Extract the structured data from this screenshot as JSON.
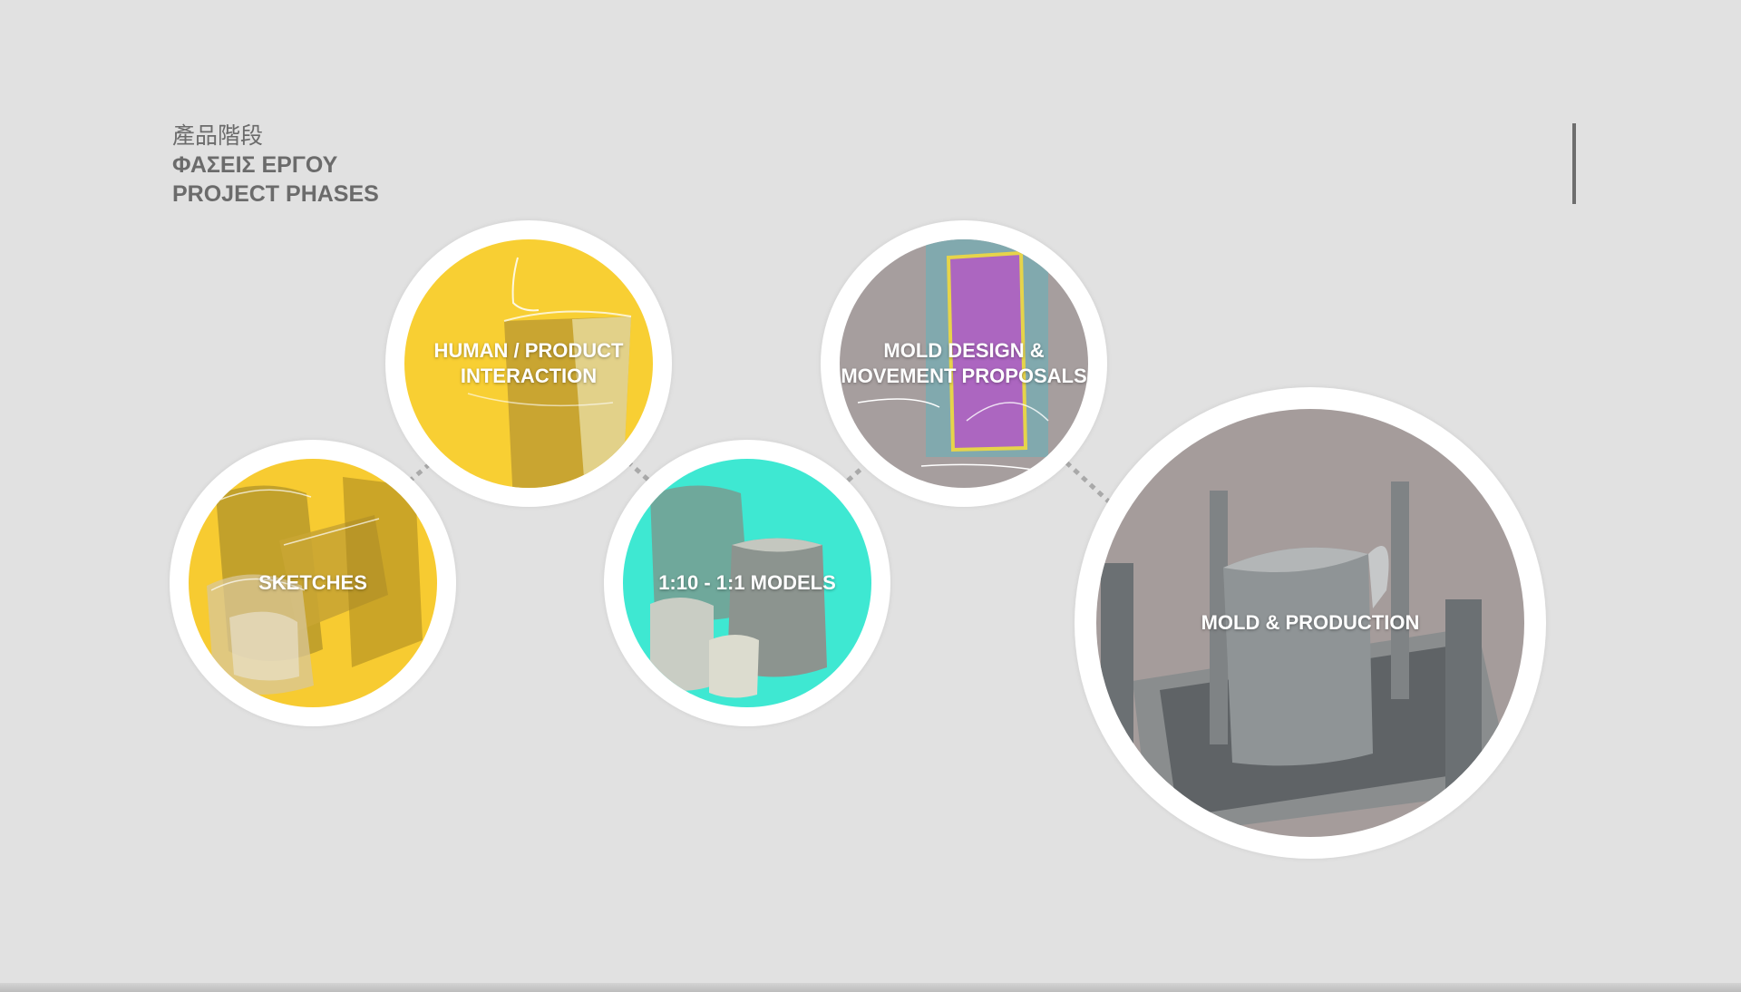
{
  "heading": {
    "line_chinese": "產品階段",
    "line_greek": "ΦΑΣΕΙΣ ΕΡΓΟΥ",
    "line_english": "PROJECT PHASES"
  },
  "phases": [
    {
      "label": "SKETCHES",
      "color": "#f7cb31"
    },
    {
      "label": "HUMAN / PRODUCT INTERACTION",
      "color": "#f8cf33"
    },
    {
      "label": "1:10 - 1:1 MODELS",
      "color": "#3ee8d2"
    },
    {
      "label": "MOLD DESIGN & MOVEMENT PROPOSALS",
      "color": "#a69e9e"
    },
    {
      "label": "MOLD & PRODUCTION",
      "color": "#a59c9b"
    }
  ],
  "colors": {
    "background": "#e1e1e1",
    "heading_text": "#6b6b6b",
    "ring": "#ffffff",
    "connector": "#a9a9a9"
  }
}
